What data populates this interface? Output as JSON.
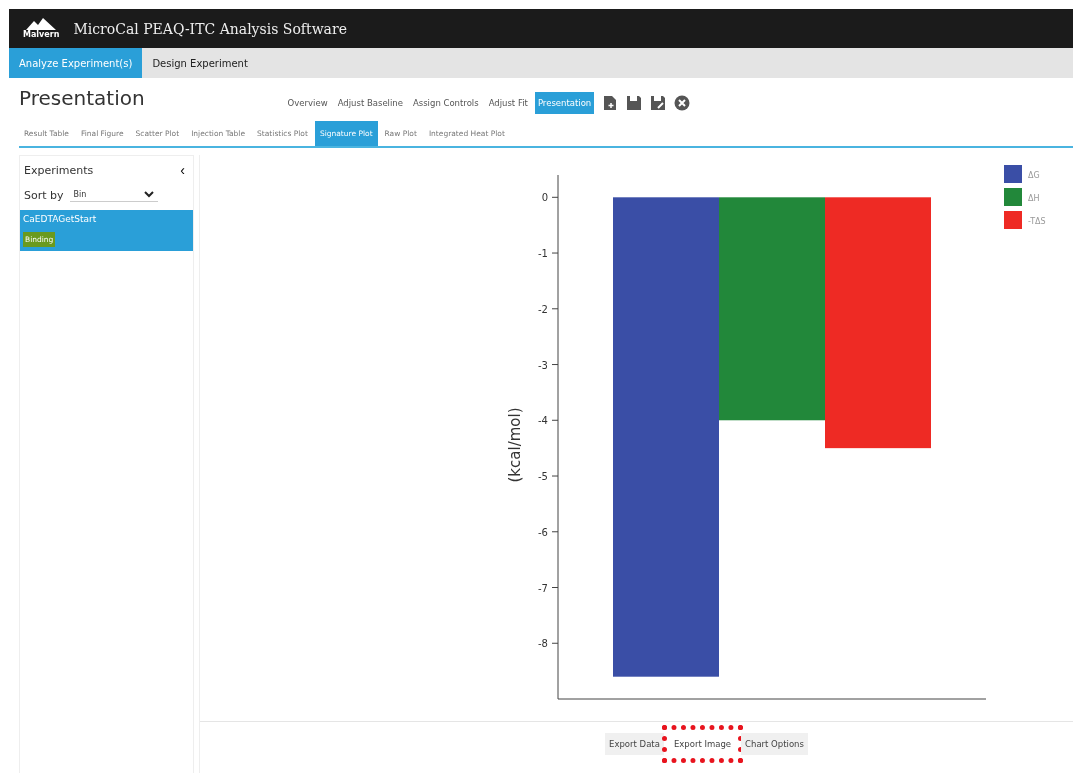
{
  "app": {
    "logo": "Malvern",
    "title": "MicroCal PEAQ-ITC Analysis Software"
  },
  "nav_tabs": [
    {
      "label": "Analyze Experiment(s)",
      "selected": true
    },
    {
      "label": "Design Experiment",
      "selected": false
    }
  ],
  "page_title": "Presentation",
  "steps": [
    {
      "label": "Overview",
      "selected": false
    },
    {
      "label": "Adjust Baseline",
      "selected": false
    },
    {
      "label": "Assign Controls",
      "selected": false
    },
    {
      "label": "Adjust Fit",
      "selected": false
    },
    {
      "label": "Presentation",
      "selected": true
    }
  ],
  "sub_tabs": [
    {
      "label": "Result Table",
      "selected": false
    },
    {
      "label": "Final Figure",
      "selected": false
    },
    {
      "label": "Scatter Plot",
      "selected": false
    },
    {
      "label": "Injection Table",
      "selected": false
    },
    {
      "label": "Statistics Plot",
      "selected": false
    },
    {
      "label": "Signature Plot",
      "selected": true
    },
    {
      "label": "Raw Plot",
      "selected": false
    },
    {
      "label": "Integrated Heat Plot",
      "selected": false
    }
  ],
  "sidebar": {
    "title": "Experiments",
    "collapse": "‹",
    "sort_label": "Sort by",
    "sort_value": "Bin",
    "experiments": [
      {
        "name": "CaEDTAGetStart",
        "tag": "Binding",
        "selected": true
      }
    ]
  },
  "chart": {
    "chart_data": {
      "type": "bar",
      "ylabel": "(kcal/mol)",
      "legend": true,
      "series": [
        {
          "name": "ΔG",
          "color": "#3a4ea6",
          "values": [
            -8.6,
            null,
            null
          ]
        },
        {
          "name": "ΔH",
          "color": "#22883a",
          "values": [
            null,
            -4.0,
            null
          ]
        },
        {
          "name": "-TΔS",
          "color": "#ee2a24",
          "values": [
            null,
            null,
            -4.5
          ]
        }
      ],
      "ylim": [
        -9,
        0.4
      ],
      "yticks": [
        0,
        -1,
        -2,
        -3,
        -4,
        -5,
        -6,
        -7,
        -8
      ]
    }
  },
  "buttons": [
    {
      "label": "Export Data",
      "highlighted": false
    },
    {
      "label": "Export Image",
      "highlighted": true
    },
    {
      "label": "Chart Options",
      "highlighted": false
    }
  ]
}
